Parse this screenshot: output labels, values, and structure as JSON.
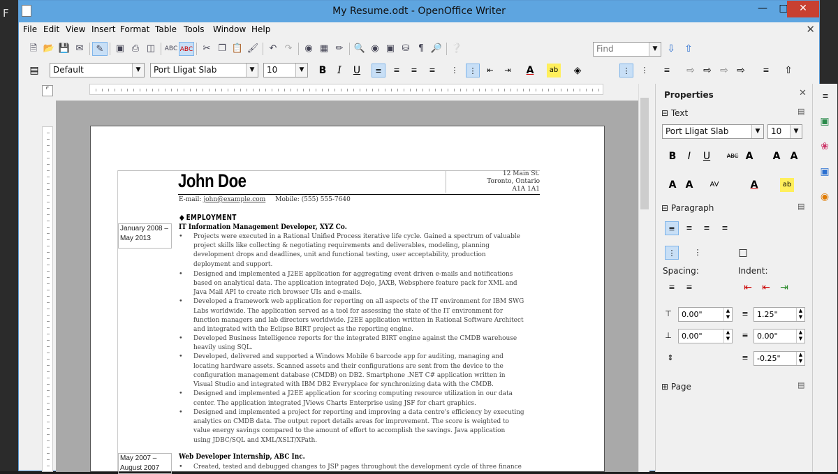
{
  "window": {
    "title": "My Resume.odt - OpenOffice Writer",
    "desktop_letter": "F"
  },
  "menu": [
    "File",
    "Edit",
    "View",
    "Insert",
    "Format",
    "Table",
    "Tools",
    "Window",
    "Help"
  ],
  "toolbar": {
    "find_placeholder": "Find"
  },
  "formatting": {
    "style": "Default",
    "font": "Port Lligat Slab",
    "size": "10"
  },
  "sidebar": {
    "title": "Properties",
    "text_section": "Text",
    "font": "Port Lligat Slab",
    "size": "10",
    "paragraph_section": "Paragraph",
    "spacing_label": "Spacing:",
    "indent_label": "Indent:",
    "above": "0.00\"",
    "below": "0.00\"",
    "before_indent": "1.25\"",
    "after_indent": "0.00\"",
    "first_line": "-0.25\"",
    "page_section": "Page"
  },
  "doc": {
    "name": "John Doe",
    "email_label": "E-mail: ",
    "email": "john@example.com",
    "mobile": "Mobile: (555) 555-7640",
    "addr1": "12 Main St.",
    "addr2": "Toronto, Ontario",
    "addr3": "A1A 1A1",
    "section": "EMPLOYMENT",
    "job1_title": "IT Information Management Developer, XYZ Co.",
    "job1_date1": "January 2008 –",
    "job1_date2": "May 2013",
    "job2_title": "Web Developer Internship, ABC Inc.",
    "job2_date1": "May 2007 –",
    "job2_date2": "August 2007",
    "lines": [
      "Projects were executed in a Rational Unified Process iterative life cycle. Gained a spectrum of valuable",
      "project skills like collecting & negotiating requirements and deliverables, modeling, planning",
      "development drops and deadlines, unit and functional testing, user acceptability, production",
      "deployment and support.",
      "Designed and implemented a J2EE application for aggregating event driven e-mails and notifications",
      "based on analytical data. The application integrated Dojo, JAXB, Websphere feature pack for XML and",
      "Java Mail API to create rich browser UIs and e-mails.",
      "Developed a framework web application for reporting on all aspects of the IT environment for IBM SWG",
      "Labs worldwide. The application served as a tool for assessing the state of the IT environment for",
      "function managers and lab directors worldwide. J2EE application written in Rational Software Architect",
      "and integrated with the Eclipse BIRT project as the reporting engine.",
      "Developed Business Intelligence reports for the integrated BIRT engine against the CMDB warehouse",
      "heavily using SQL.",
      "Developed, delivered and supported a Windows Mobile 6 barcode app for auditing, managing and",
      "locating hardware assets. Scanned assets and their configurations are sent from the device to the",
      "configuration management database (CMDB) on DB2. Smartphone .NET C# application written in",
      "Visual Studio and integrated with IBM DB2 Everyplace for synchronizing data with the CMDB.",
      "Designed and implemented a J2EE application for scoring computing resource utilization in our data",
      "center. The application integrated JViews Charts Enterprise using JSF for chart graphics.",
      "Designed and implemented a project for reporting and improving a data centre's efficiency by executing",
      "analytics on CMDB data. The output report details areas for improvement. The score is weighted to",
      "value energy savings compared to the amount of effort to accomplish the savings. Java application",
      "using JDBC/SQL and XML/XSLT/XPath.",
      "Created, tested and debugged changes to JSP pages throughout the development cycle of three finance"
    ]
  }
}
